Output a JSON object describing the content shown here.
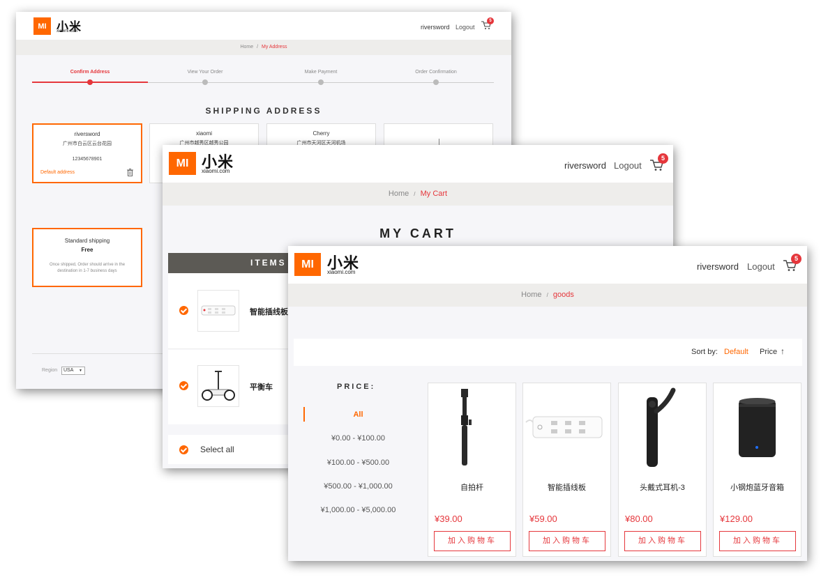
{
  "brand": {
    "logo_mark": "MI",
    "name_cn": "小米",
    "name_en": "xiaomi.com",
    "color": "#ff6700"
  },
  "user": {
    "name": "riversword",
    "logout": "Logout",
    "cart_count": "5"
  },
  "address_page": {
    "breadcrumb": {
      "home": "Home",
      "separator": "/",
      "current": "My Address"
    },
    "steps": [
      "Confirm Address",
      "View Your Order",
      "Make Payment",
      "Order Confirmation"
    ],
    "title": "SHIPPING ADDRESS",
    "addresses": [
      {
        "name": "riversword",
        "line": "广州市白云区云台花园",
        "phone": "12345678901",
        "default_label": "Default address"
      },
      {
        "name": "xiaomi",
        "line": "广州市越秀区越秀公园"
      },
      {
        "name": "Cherry",
        "line": "广州市天河区天河机场"
      }
    ],
    "shipping": {
      "title": "Standard shipping",
      "price": "Free",
      "note": "Once shipped,  Order should arrive in the destination in 1-7 business days"
    },
    "region": {
      "label": "Region",
      "value": "USA"
    }
  },
  "cart_page": {
    "breadcrumb": {
      "home": "Home",
      "separator": "/",
      "current": "My Cart"
    },
    "title": "MY CART",
    "items_header": "ITEMS",
    "items": [
      {
        "name": "智能插线板"
      },
      {
        "name": "平衡车"
      }
    ],
    "select_all": "Select all"
  },
  "goods_page": {
    "breadcrumb": {
      "home": "Home",
      "separator": "/",
      "current": "goods"
    },
    "sort": {
      "label": "Sort by:",
      "default": "Default",
      "price": "Price",
      "arrow": "↑"
    },
    "price_filter": {
      "title": "PRICE:",
      "ranges": [
        "All",
        "¥0.00 - ¥100.00",
        "¥100.00 - ¥500.00",
        "¥500.00 - ¥1,000.00",
        "¥1,000.00 - ¥5,000.00"
      ]
    },
    "products": [
      {
        "name": "自拍杆",
        "price": "¥39.00",
        "button": "加入购物车"
      },
      {
        "name": "智能插线板",
        "price": "¥59.00",
        "button": "加入购物车"
      },
      {
        "name": "头戴式耳机-3",
        "price": "¥80.00",
        "button": "加入购物车"
      },
      {
        "name": "小钢炮蓝牙音箱",
        "price": "¥129.00",
        "button": "加入购物车"
      }
    ]
  },
  "colors": {
    "accent": "#ff6700",
    "price_red": "#e5363b",
    "header_dark": "#5c5a55"
  }
}
